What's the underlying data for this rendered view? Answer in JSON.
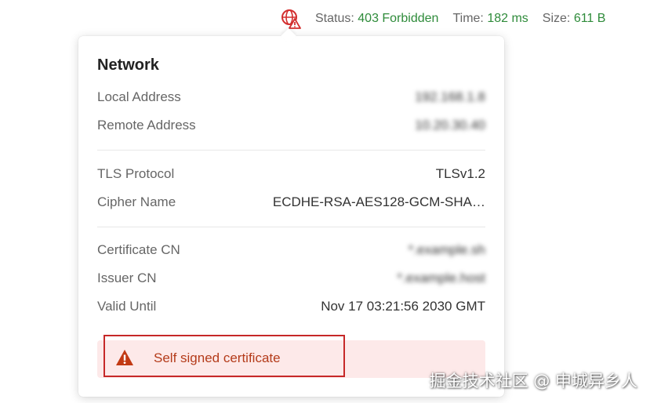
{
  "statusbar": {
    "icon": "globe-warning-icon",
    "status_label": "Status:",
    "status_value": "403 Forbidden",
    "time_label": "Time:",
    "time_value": "182 ms",
    "size_label": "Size:",
    "size_value": "611 B"
  },
  "popover": {
    "title": "Network",
    "rows": [
      {
        "key": "Local Address",
        "value": "192.168.1.8"
      },
      {
        "key": "Remote Address",
        "value": "10.20.30.40"
      },
      {
        "key": "TLS Protocol",
        "value": "TLSv1.2"
      },
      {
        "key": "Cipher Name",
        "value": "ECDHE-RSA-AES128-GCM-SHA…"
      },
      {
        "key": "Certificate CN",
        "value": "*.example.sh"
      },
      {
        "key": "Issuer CN",
        "value": "*.example.host"
      },
      {
        "key": "Valid Until",
        "value": "Nov 17 03:21:56 2030 GMT"
      }
    ],
    "warning": {
      "icon": "warning-triangle-icon",
      "text": "Self signed certificate"
    }
  },
  "watermark": "掘金技术社区 @ 申城异乡人",
  "colors": {
    "status_ok": "#2e8b3a",
    "warning_bg": "#fde9e9",
    "warning_text": "#b43b1a",
    "highlight_border": "#c62828",
    "icon_red": "#d32f2f"
  }
}
